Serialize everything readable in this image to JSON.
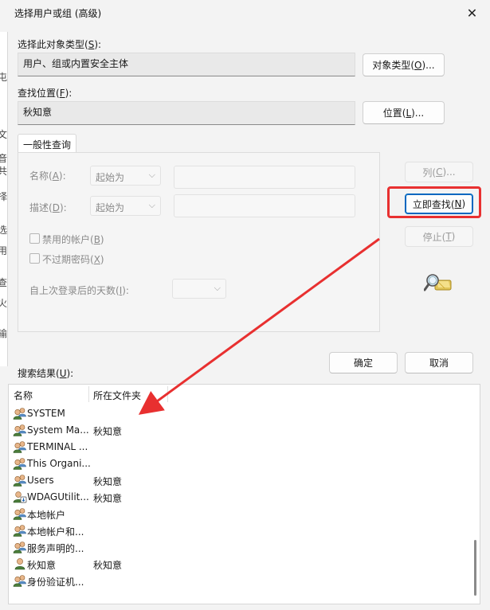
{
  "window": {
    "title": "选择用户或组 (高级)"
  },
  "left_strip": [
    "屯",
    "文",
    "音",
    "共",
    "择",
    "选",
    "用",
    "查",
    "火",
    "输"
  ],
  "object_type": {
    "label": "选择此对象类型(",
    "key": "S",
    "label_end": "):",
    "value": "用户、组或内置安全主体",
    "button": "对象类型(",
    "button_key": "O",
    "button_end": ")..."
  },
  "location": {
    "label": "查找位置(",
    "key": "F",
    "label_end": "):",
    "value": "秋知意",
    "button": "位置(",
    "button_key": "L",
    "button_end": ")..."
  },
  "tab": {
    "label": "一般性查询"
  },
  "query": {
    "name_label": "名称(",
    "name_key": "A",
    "name_end": "):",
    "name_mode": "起始为",
    "desc_label": "描述(",
    "desc_key": "D",
    "desc_end": "):",
    "desc_mode": "起始为",
    "disabled_accounts": "禁用的帐户(",
    "disabled_key": "B",
    "disabled_end": ")",
    "non_expiring": "不过期密码(",
    "non_expiring_key": "X",
    "non_expiring_end": ")",
    "days_label": "自上次登录后的天数(",
    "days_key": "I",
    "days_end": "):"
  },
  "side_buttons": {
    "columns": "列(",
    "columns_key": "C",
    "columns_end": ")...",
    "find_now": "立即查找(",
    "find_now_key": "N",
    "find_now_end": ")",
    "stop": "停止(",
    "stop_key": "T",
    "stop_end": ")"
  },
  "actions": {
    "ok": "确定",
    "cancel": "取消"
  },
  "results": {
    "label": "搜索结果(",
    "label_key": "U",
    "label_end": "):",
    "columns": [
      "名称",
      "所在文件夹"
    ],
    "rows": [
      {
        "name": "SYSTEM",
        "folder": "",
        "icon": "group-icon"
      },
      {
        "name": "System Ma...",
        "folder": "秋知意",
        "icon": "group-icon"
      },
      {
        "name": "TERMINAL ...",
        "folder": "",
        "icon": "group-icon"
      },
      {
        "name": "This Organi...",
        "folder": "",
        "icon": "group-icon"
      },
      {
        "name": "Users",
        "folder": "秋知意",
        "icon": "group-icon"
      },
      {
        "name": "WDAGUtilit...",
        "folder": "秋知意",
        "icon": "user-download-icon"
      },
      {
        "name": "本地帐户",
        "folder": "",
        "icon": "group-icon"
      },
      {
        "name": "本地帐户和...",
        "folder": "",
        "icon": "group-icon"
      },
      {
        "name": "服务声明的...",
        "folder": "",
        "icon": "group-icon"
      },
      {
        "name": "秋知意",
        "folder": "秋知意",
        "icon": "user-icon"
      },
      {
        "name": "身份验证机...",
        "folder": "",
        "icon": "group-icon"
      }
    ]
  },
  "colors": {
    "highlight": "#e83030",
    "accent": "#0067c0"
  }
}
